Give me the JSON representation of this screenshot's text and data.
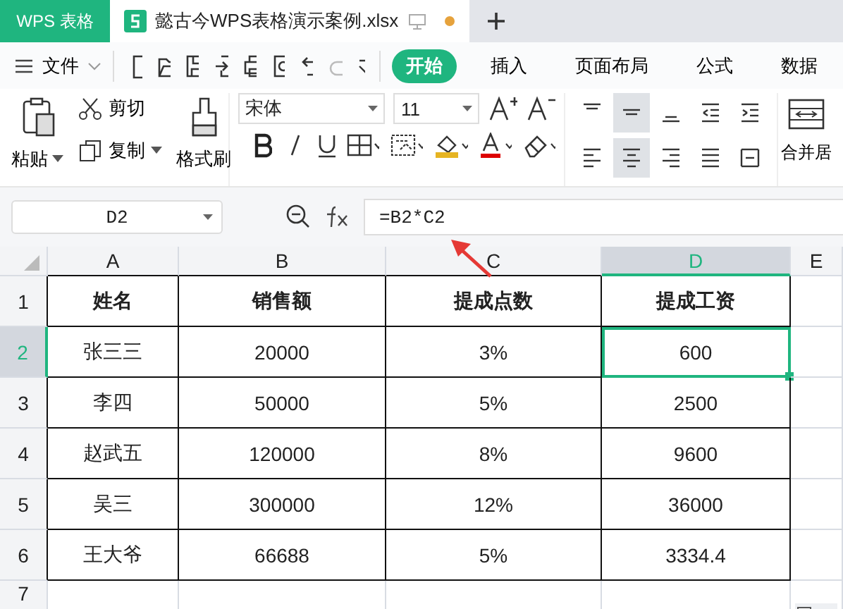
{
  "app_tabs": [
    {
      "label": "WPS 表格",
      "kind": "home",
      "selected": false
    },
    {
      "label": "懿古今WPS表格演示案例.xlsx",
      "kind": "document",
      "selected": true,
      "unsaved": true
    }
  ],
  "file_menu": "文件",
  "ribbon_tabs": [
    {
      "label": "开始",
      "selected": true
    },
    {
      "label": "插入",
      "selected": false
    },
    {
      "label": "页面布局",
      "selected": false
    },
    {
      "label": "公式",
      "selected": false
    },
    {
      "label": "数据",
      "selected": false
    }
  ],
  "clipboard": {
    "paste": "粘贴",
    "cut": "剪切",
    "copy": "复制",
    "format_painter": "格式刷"
  },
  "font": {
    "name": "宋体",
    "size": "11"
  },
  "alignment": [
    {
      "kind": "top",
      "selected": false
    },
    {
      "kind": "middle",
      "selected": true
    },
    {
      "kind": "bottom",
      "selected": false
    },
    {
      "kind": "outdent",
      "selected": false
    },
    {
      "kind": "indent",
      "selected": false
    },
    {
      "kind": "left",
      "selected": false
    },
    {
      "kind": "center",
      "selected": true
    },
    {
      "kind": "right",
      "selected": false
    },
    {
      "kind": "justify",
      "selected": false
    },
    {
      "kind": "distributed",
      "selected": false
    }
  ],
  "merge_button": "合并居",
  "name_box": "D2",
  "formula": "=B2*C2",
  "sheet": {
    "columns": [
      {
        "label": "A",
        "selected": false
      },
      {
        "label": "B",
        "selected": false
      },
      {
        "label": "C",
        "selected": false
      },
      {
        "label": "D",
        "selected": true
      },
      {
        "label": "E",
        "selected": false
      }
    ],
    "rows": [
      {
        "number": "1",
        "selected": false,
        "header": true,
        "cells": [
          "姓名",
          "销售额",
          "提成点数",
          "提成工资"
        ]
      },
      {
        "number": "2",
        "selected": true,
        "cells": [
          "张三三",
          "20000",
          "3%",
          "600"
        ]
      },
      {
        "number": "3",
        "selected": false,
        "cells": [
          "李四",
          "50000",
          "5%",
          "2500"
        ]
      },
      {
        "number": "4",
        "selected": false,
        "cells": [
          "赵武五",
          "120000",
          "8%",
          "9600"
        ]
      },
      {
        "number": "5",
        "selected": false,
        "cells": [
          "吴三",
          "300000",
          "12%",
          "36000"
        ]
      },
      {
        "number": "6",
        "selected": false,
        "cells": [
          "王大爷",
          "66688",
          "5%",
          "3334.4"
        ]
      },
      {
        "number": "7",
        "selected": false,
        "cells": []
      }
    ]
  }
}
